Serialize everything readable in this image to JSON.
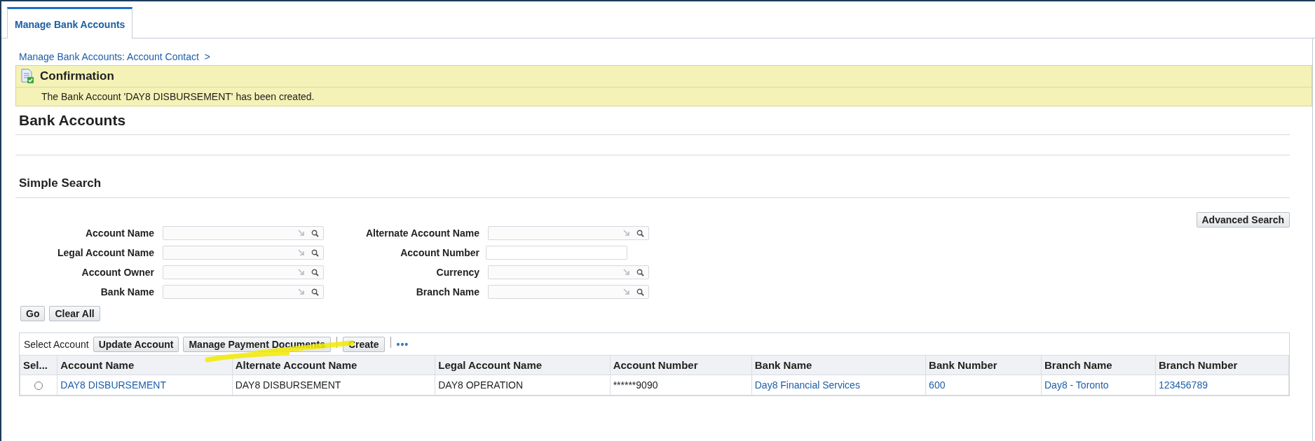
{
  "tabs": [
    {
      "label": "Manage Bank Accounts",
      "selected": true
    }
  ],
  "breadcrumb": {
    "link": "Manage Bank Accounts: Account Contact",
    "separator": ">"
  },
  "confirmation": {
    "title": "Confirmation",
    "message": "The Bank Account 'DAY8 DISBURSEMENT' has been created."
  },
  "page_title": "Bank Accounts",
  "search": {
    "title": "Simple Search",
    "advanced_button": "Advanced Search",
    "left_fields": [
      {
        "label": "Account Name",
        "kind": "lov"
      },
      {
        "label": "Legal Account Name",
        "kind": "lov"
      },
      {
        "label": "Account Owner",
        "kind": "lov"
      },
      {
        "label": "Bank Name",
        "kind": "lov"
      }
    ],
    "right_fields": [
      {
        "label": "Alternate Account Name",
        "kind": "lov"
      },
      {
        "label": "Account Number",
        "kind": "text"
      },
      {
        "label": "Currency",
        "kind": "lov"
      },
      {
        "label": "Branch Name",
        "kind": "lov"
      }
    ],
    "buttons": [
      "Go",
      "Clear All"
    ]
  },
  "table": {
    "toolbar_label": "Select Account",
    "actions": [
      "Update Account",
      "Manage Payment Documents",
      "Create"
    ],
    "more": "•••",
    "columns": [
      "Sel...",
      "Account Name",
      "Alternate Account Name",
      "Legal Account Name",
      "Account Number",
      "Bank Name",
      "Bank Number",
      "Branch Name",
      "Branch Number"
    ],
    "rows": [
      {
        "selected": false,
        "cells": [
          {
            "kind": "radio"
          },
          {
            "text": "DAY8 DISBURSEMENT",
            "kind": "link"
          },
          {
            "text": "DAY8 DISBURSEMENT",
            "kind": "text"
          },
          {
            "text": "DAY8 OPERATION",
            "kind": "text"
          },
          {
            "text": "******9090",
            "kind": "text"
          },
          {
            "text": "Day8 Financial Services",
            "kind": "link"
          },
          {
            "text": "600",
            "kind": "link"
          },
          {
            "text": "Day8 - Toronto",
            "kind": "link"
          },
          {
            "text": "123456789",
            "kind": "link"
          }
        ]
      }
    ]
  }
}
